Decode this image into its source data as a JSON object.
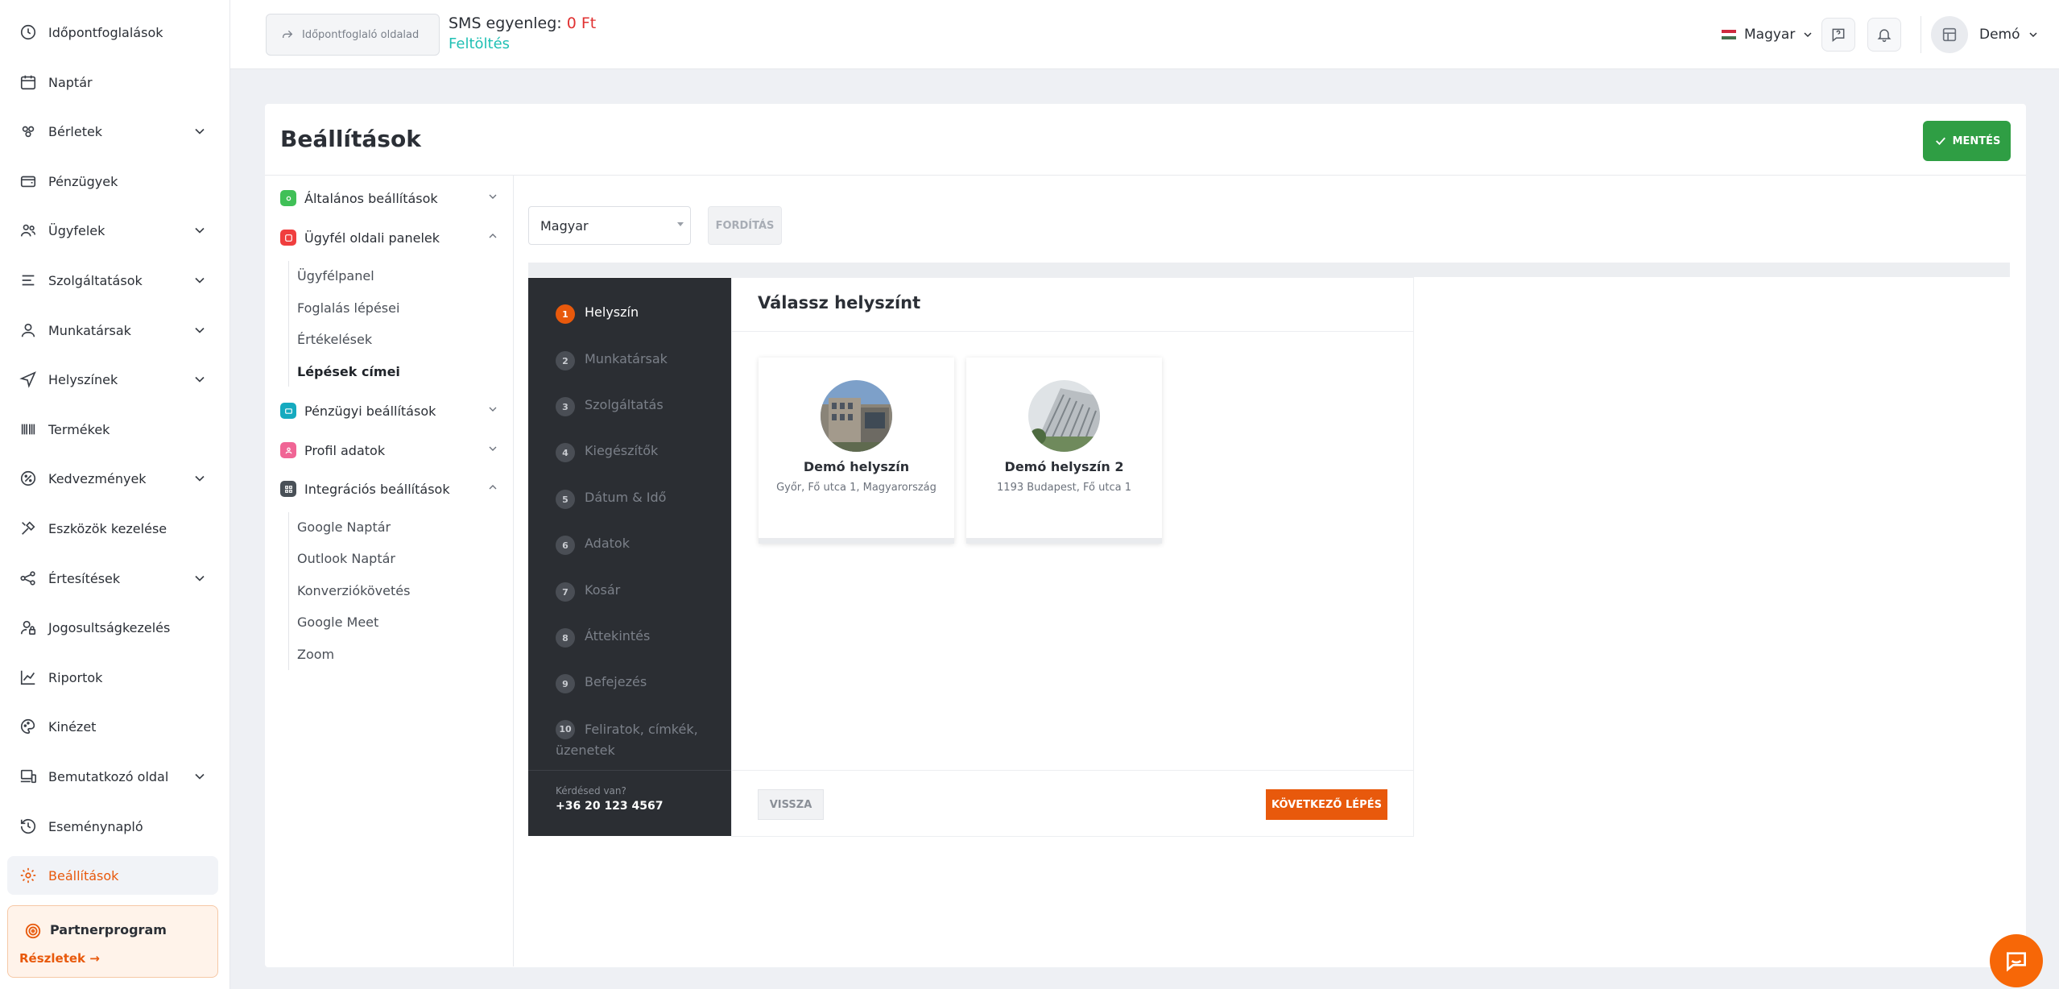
{
  "sidebar": {
    "items": [
      {
        "label": "Időpontfoglalások",
        "icon": "clock-icon",
        "chevron": false
      },
      {
        "label": "Naptár",
        "icon": "calendar-icon",
        "chevron": false
      },
      {
        "label": "Bérletek",
        "icon": "ticket-icon",
        "chevron": true
      },
      {
        "label": "Pénzügyek",
        "icon": "wallet-icon",
        "chevron": false
      },
      {
        "label": "Ügyfelek",
        "icon": "users-icon",
        "chevron": true
      },
      {
        "label": "Szolgáltatások",
        "icon": "list-icon",
        "chevron": true
      },
      {
        "label": "Munkatársak",
        "icon": "user-icon",
        "chevron": true
      },
      {
        "label": "Helyszínek",
        "icon": "navigation-icon",
        "chevron": true
      },
      {
        "label": "Termékek",
        "icon": "barcode-icon",
        "chevron": false
      },
      {
        "label": "Kedvezmények",
        "icon": "discount-icon",
        "chevron": true
      },
      {
        "label": "Eszközök kezelése",
        "icon": "tools-icon",
        "chevron": false
      },
      {
        "label": "Értesítések",
        "icon": "share-icon",
        "chevron": true
      },
      {
        "label": "Jogosultságkezelés",
        "icon": "user-lock-icon",
        "chevron": false
      },
      {
        "label": "Riportok",
        "icon": "chart-icon",
        "chevron": false
      },
      {
        "label": "Kinézet",
        "icon": "palette-icon",
        "chevron": false
      },
      {
        "label": "Bemutatkozó oldal",
        "icon": "devices-icon",
        "chevron": true
      },
      {
        "label": "Eseménynapló",
        "icon": "history-icon",
        "chevron": false
      },
      {
        "label": "Beállítások",
        "icon": "gear-icon",
        "chevron": false,
        "active": true
      }
    ],
    "partner": {
      "title": "Partnerprogram",
      "link": "Részletek →"
    }
  },
  "topbar": {
    "booking_page_label": "Időpontfoglaló oldalad",
    "sms_label": "SMS egyenleg: ",
    "sms_amount": "0 Ft",
    "topup_label": "Feltöltés",
    "language": "Magyar",
    "user_name": "Demó"
  },
  "page": {
    "title": "Beállítások",
    "save_label": "MENTÉS"
  },
  "settings_tree": {
    "general": "Általános beállítások",
    "client_panels": "Ügyfél oldali panelek",
    "client_panels_items": [
      "Ügyfélpanel",
      "Foglalás lépései",
      "Értékelések",
      "Lépések címei"
    ],
    "finance": "Pénzügyi beállítások",
    "profile": "Profil adatok",
    "integrations": "Integrációs beállítások",
    "integrations_items": [
      "Google Naptár",
      "Outlook Naptár",
      "Konverziókövetés",
      "Google Meet",
      "Zoom"
    ]
  },
  "editor": {
    "language_value": "Magyar",
    "translate_label": "FORDÍTÁS"
  },
  "widget": {
    "steps": [
      {
        "num": "1",
        "label": "Helyszín"
      },
      {
        "num": "2",
        "label": "Munkatársak"
      },
      {
        "num": "3",
        "label": "Szolgáltatás"
      },
      {
        "num": "4",
        "label": "Kiegészítők"
      },
      {
        "num": "5",
        "label": "Dátum & Idő"
      },
      {
        "num": "6",
        "label": "Adatok"
      },
      {
        "num": "7",
        "label": "Kosár"
      },
      {
        "num": "8",
        "label": "Áttekintés"
      },
      {
        "num": "9",
        "label": "Befejezés"
      },
      {
        "num": "10",
        "label": "Feliratok, címkék, üzenetek"
      }
    ],
    "question": "Kérdésed van?",
    "phone": "+36 20 123 4567",
    "title": "Válassz helyszínt",
    "locations": [
      {
        "name": "Demó helyszín",
        "address": "Győr, Fő utca 1, Magyarország"
      },
      {
        "name": "Demó helyszín 2",
        "address": "1193 Budapest, Fő utca 1"
      }
    ],
    "back_label": "VISSZA",
    "next_label": "KÖVETKEZŐ LÉPÉS"
  },
  "colors": {
    "accent": "#e8590c",
    "save_green": "#2f9e44",
    "topup_teal": "#20c0b4",
    "sms_red": "#e03131",
    "widget_sidebar": "#2b2e33"
  }
}
